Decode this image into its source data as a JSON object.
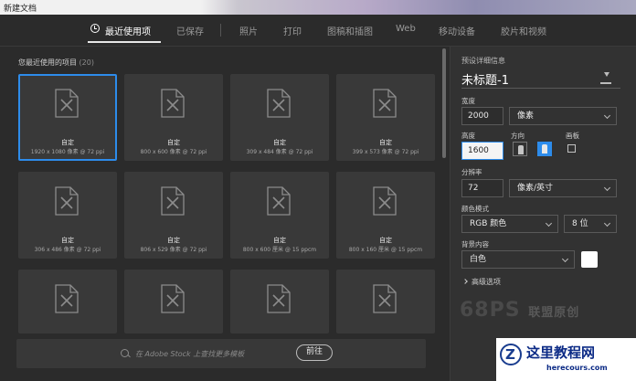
{
  "window": {
    "title": "新建文档"
  },
  "tabs": [
    {
      "label": "最近使用项"
    },
    {
      "label": "已保存"
    },
    {
      "label": "照片"
    },
    {
      "label": "打印"
    },
    {
      "label": "图稿和插图"
    },
    {
      "label": "Web"
    },
    {
      "label": "移动设备"
    },
    {
      "label": "胶片和视频"
    }
  ],
  "recent": {
    "title": "您最近使用的项目",
    "count": "(20)",
    "items": [
      {
        "name": "自定",
        "dims": "1920 x 1080 像素 @ 72 ppi"
      },
      {
        "name": "自定",
        "dims": "800 x 600 像素 @ 72 ppi"
      },
      {
        "name": "自定",
        "dims": "309 x 484 像素 @ 72 ppi"
      },
      {
        "name": "自定",
        "dims": "399 x 573 像素 @ 72 ppi"
      },
      {
        "name": "自定",
        "dims": "306 x 486 像素 @ 72 ppi"
      },
      {
        "name": "自定",
        "dims": "806 x 529 像素 @ 72 ppi"
      },
      {
        "name": "自定",
        "dims": "800 x 600 厘米 @ 15 ppcm"
      },
      {
        "name": "自定",
        "dims": "800 x 160 厘米 @ 15 ppcm"
      },
      {
        "name": "",
        "dims": ""
      },
      {
        "name": "",
        "dims": ""
      },
      {
        "name": "",
        "dims": ""
      },
      {
        "name": "",
        "dims": ""
      }
    ]
  },
  "search": {
    "placeholder": "在 Adobe Stock 上查找更多模板",
    "go_label": "前往"
  },
  "preset": {
    "heading": "预设详细信息",
    "name": "未标题-1",
    "width_label": "宽度",
    "width_value": "2000",
    "width_unit": "像素",
    "height_label": "高度",
    "height_value": "1600",
    "orientation_label": "方向",
    "artboard_label": "画板",
    "resolution_label": "分辨率",
    "resolution_value": "72",
    "resolution_unit": "像素/英寸",
    "color_mode_label": "颜色模式",
    "color_mode_value": "RGB 颜色",
    "bit_depth_value": "8 位",
    "background_label": "背景内容",
    "background_value": "白色",
    "background_swatch": "#ffffff",
    "advanced_label": "高级选项"
  },
  "watermarks": {
    "ps_text": "68PS",
    "ps_sub": "联盟原创",
    "site_title": "这里教程网",
    "site_url": "herecours.com"
  },
  "colors": {
    "accent": "#2d8ceb",
    "panel": "#323232",
    "background": "#2b2b2b"
  }
}
